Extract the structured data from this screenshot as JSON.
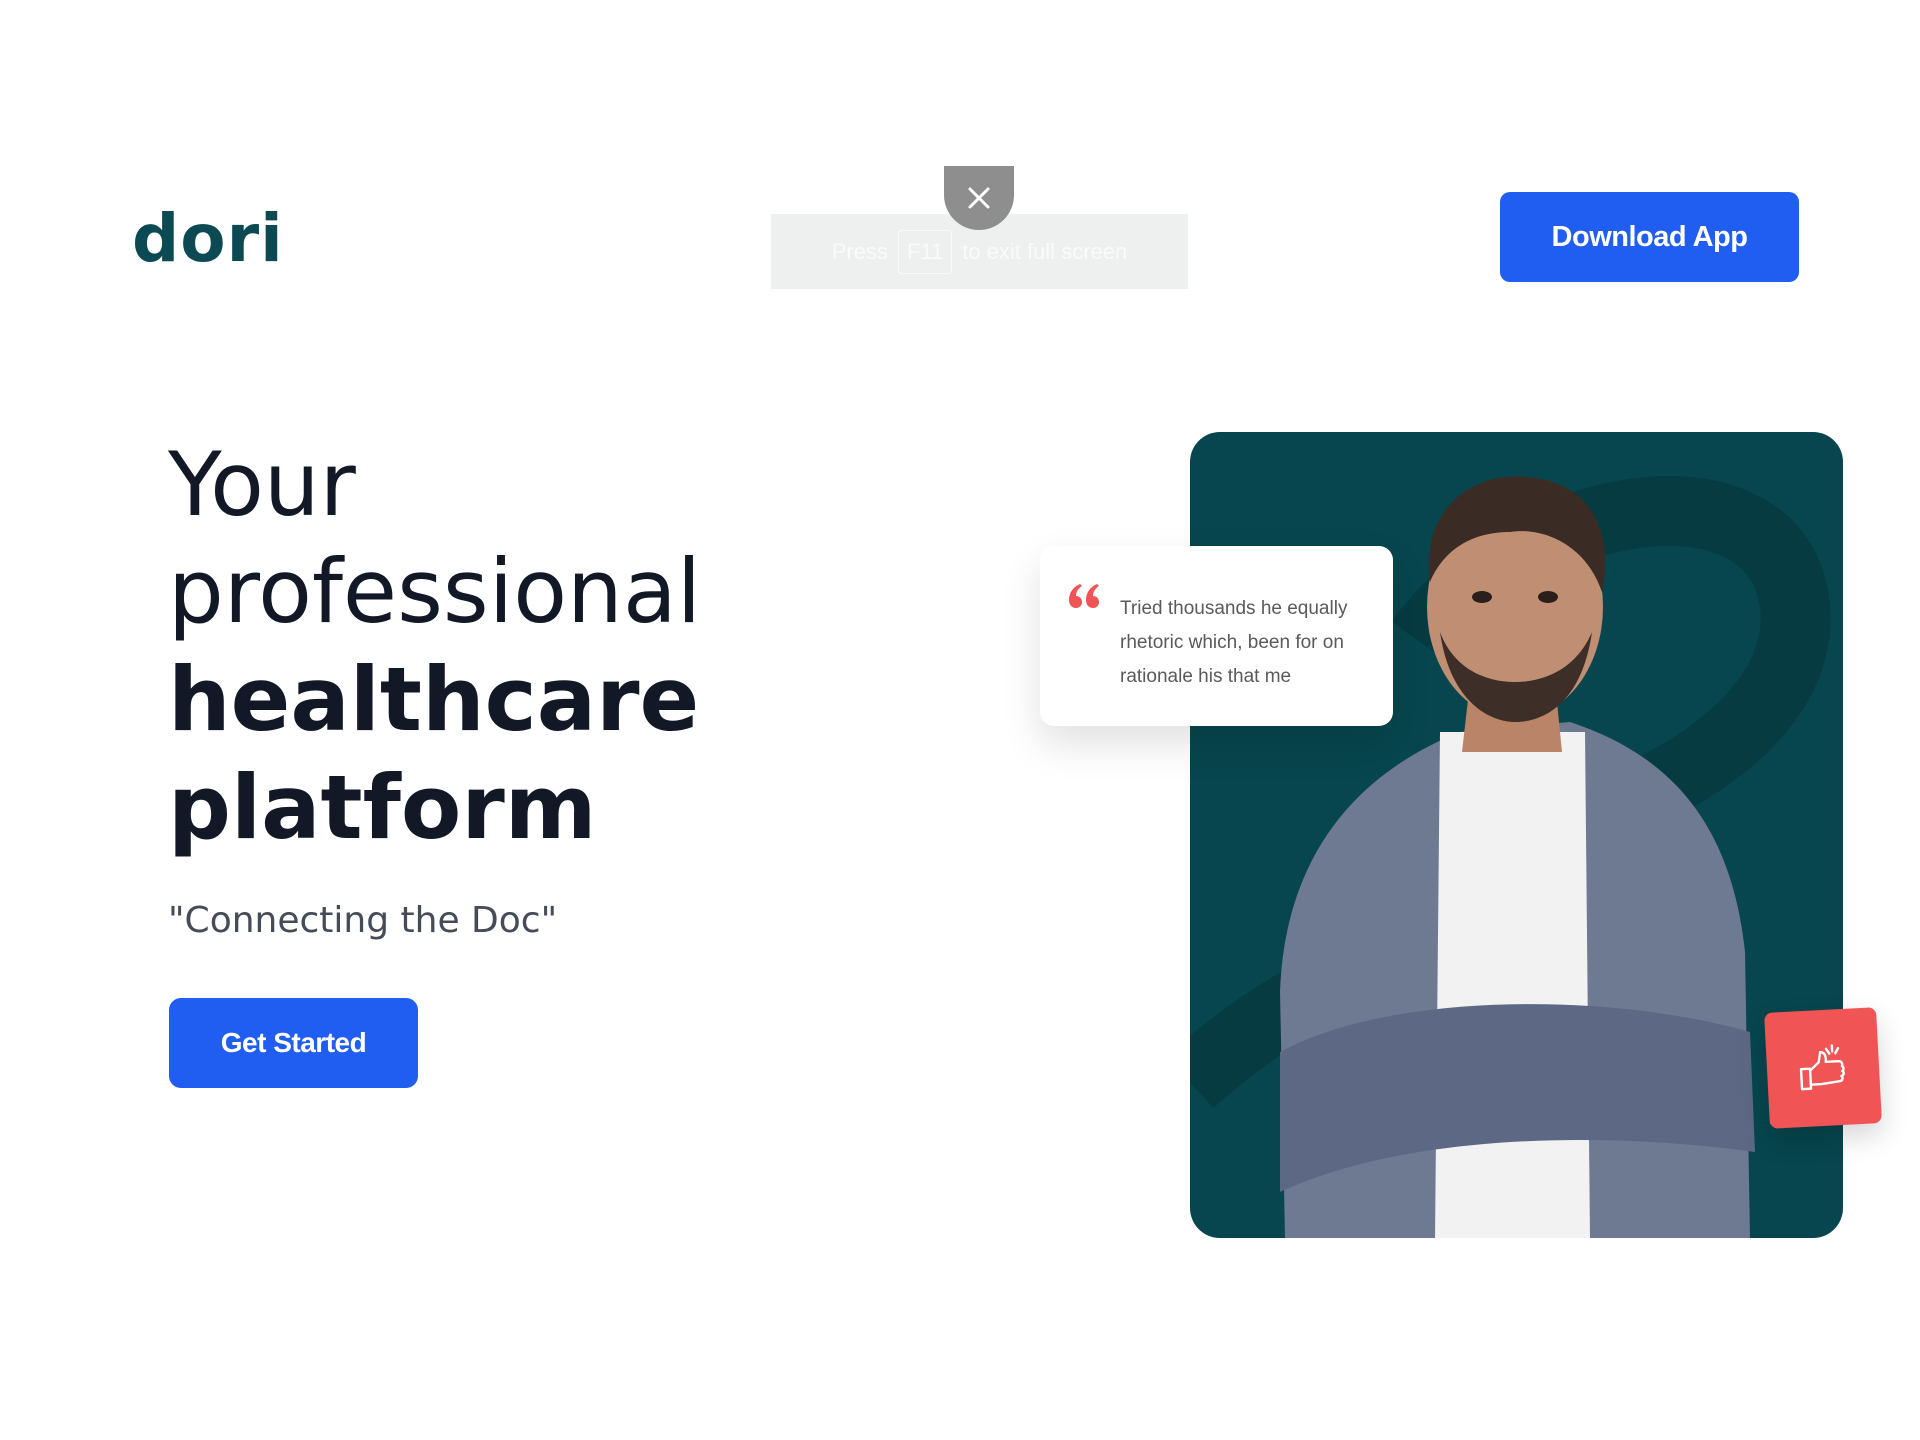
{
  "header": {
    "logo": "dori",
    "download_label": "Download App"
  },
  "fullscreen_notice": {
    "prefix": "Press",
    "key": "F11",
    "suffix": "to exit full screen"
  },
  "hero": {
    "line1": "Your",
    "line2": "professional",
    "line3": "healthcare",
    "line4": "platform",
    "tagline": "\"Connecting the Doc\"",
    "cta_label": "Get Started"
  },
  "testimonial": {
    "quote": "Tried thousands he equally rhetoric which, been for on rationale his that me"
  },
  "icons": {
    "close": "close-icon",
    "quote": "quote-icon",
    "thumbs_up": "thumbs-up-icon"
  },
  "colors": {
    "brand": "#0b4a52",
    "primary": "#1f5ef1",
    "card_bg": "#07464e",
    "accent": "#f05454",
    "heading": "#121826"
  }
}
